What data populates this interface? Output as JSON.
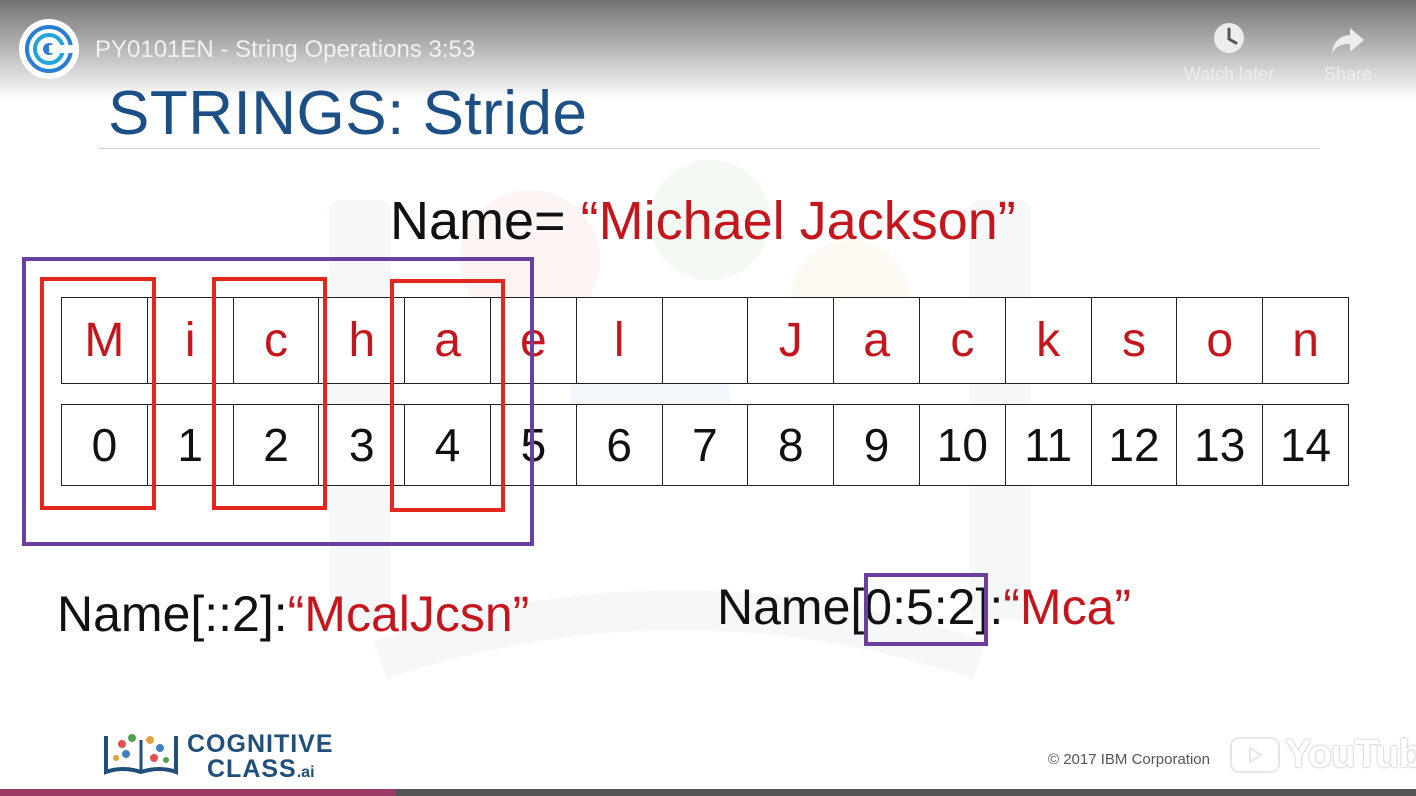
{
  "header": {
    "video_title": "PY0101EN - String Operations 3:53",
    "watch_later_label": "Watch later",
    "share_label": "Share"
  },
  "slide": {
    "title": "STRINGS: Stride",
    "assignment_prefix": "Name=",
    "assignment_value": "“Michael Jackson”",
    "characters": [
      "M",
      "i",
      "c",
      "h",
      "a",
      "e",
      "l",
      " ",
      "J",
      "a",
      "c",
      "k",
      "s",
      "o",
      "n"
    ],
    "indices": [
      "0",
      "1",
      "2",
      "3",
      "4",
      "5",
      "6",
      "7",
      "8",
      "9",
      "10",
      "11",
      "12",
      "13",
      "14"
    ],
    "example1_expr": "Name[::2]:",
    "example1_result": "“McalJcsn”",
    "example2_name": "Name",
    "example2_slice": "[0:5",
    "example2_rest": ":2]:",
    "example2_result": "“Mca”"
  },
  "footer": {
    "logo_line1": "COGNITIVE",
    "logo_line2": "CLASS",
    "logo_suffix": ".ai",
    "copyright": "© 2017 IBM Corporation",
    "youtube_wordmark": "YouTube"
  },
  "player": {
    "progress_fraction": 0.28
  },
  "colors": {
    "accent_red": "#c4161c",
    "title_blue": "#1b4f86",
    "highlight_purple": "#6b3fa0",
    "box_red": "#e3261e"
  }
}
